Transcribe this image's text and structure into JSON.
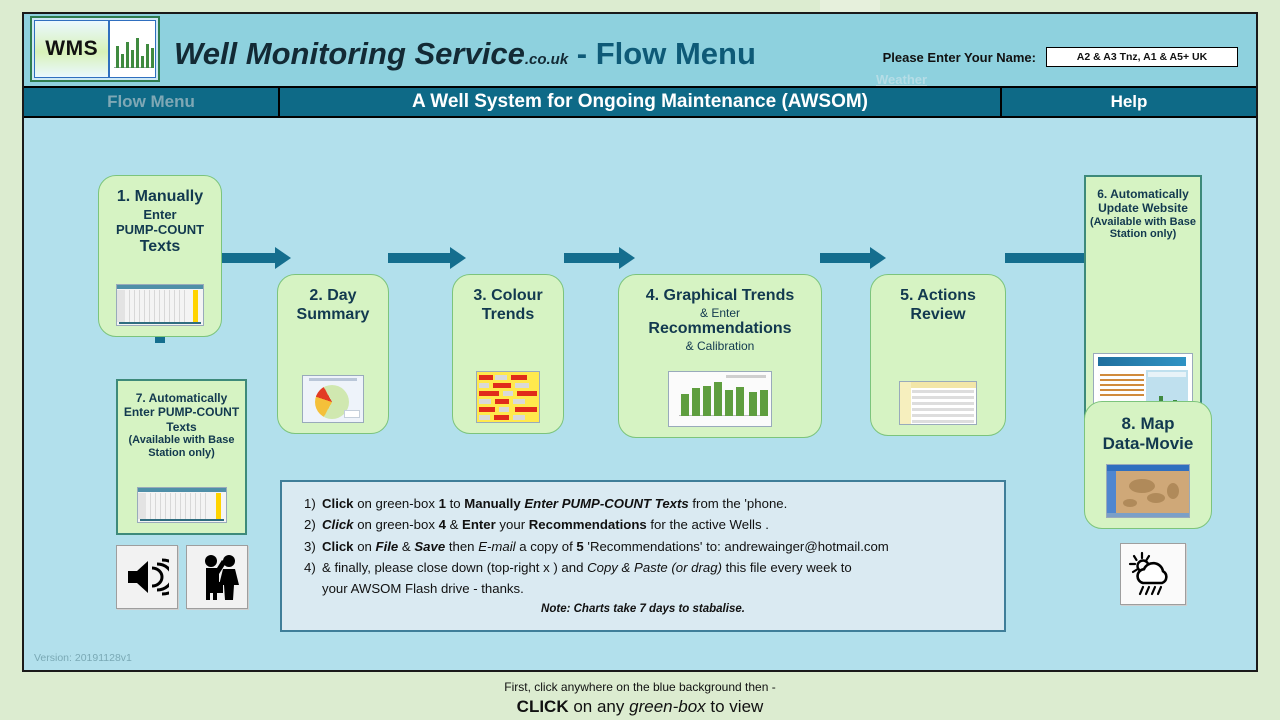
{
  "header": {
    "logo_word": "WMS",
    "brand_name": "Well Monitoring Service",
    "brand_tld": ".co.uk",
    "brand_suffix": " - Flow Menu",
    "name_label": "Please Enter Your Name:",
    "name_value": "A2 & A3 Tnz, A1 & A5+ UK",
    "weather_link": "Weather"
  },
  "nav": {
    "flow_menu": "Flow Menu",
    "title": "A Well System for Ongoing Maintenance  (AWSOM)",
    "help": "Help"
  },
  "boxes": {
    "b1": {
      "l1": "1. Manually",
      "l2": "Enter",
      "l3": "PUMP-COUNT",
      "l4": "Texts"
    },
    "b2": {
      "l1": "2. Day",
      "l2": "Summary"
    },
    "b3": {
      "l1": "3. Colour",
      "l2": "Trends"
    },
    "b4": {
      "l1": "4. Graphical Trends",
      "l2": "& Enter",
      "l3": "Recommendations",
      "l4": "& Calibration"
    },
    "b5": {
      "l1": "5. Actions",
      "l2": "Review"
    },
    "b6": {
      "l1": "6. Automatically",
      "l2": "Update Website",
      "l3": "(Available with Base",
      "l4": "Station only)"
    },
    "b7": {
      "l1": "7. Automatically",
      "l2": "Enter PUMP-COUNT",
      "l3": "Texts",
      "l4": "(Available with Base",
      "l5": "Station only)"
    },
    "b8": {
      "l1": "8. Map",
      "l2": "Data-Movie"
    }
  },
  "instructions": {
    "items": [
      {
        "num": "1)",
        "parts": [
          {
            "t": "Click",
            "s": "b"
          },
          {
            "t": " on green-box ",
            "s": "n"
          },
          {
            "t": "1",
            "s": "b"
          },
          {
            "t": " to ",
            "s": "n"
          },
          {
            "t": "Manually ",
            "s": "b"
          },
          {
            "t": "Enter PUMP-COUNT Texts",
            "s": "bi"
          },
          {
            "t": "  from the 'phone.",
            "s": "n"
          }
        ]
      },
      {
        "num": "2)",
        "parts": [
          {
            "t": "Click",
            "s": "bi"
          },
          {
            "t": "  on  green-box ",
            "s": "n"
          },
          {
            "t": "4",
            "s": "b"
          },
          {
            "t": " & ",
            "s": "n"
          },
          {
            "t": "Enter",
            "s": "b"
          },
          {
            "t": " your ",
            "s": "n"
          },
          {
            "t": "Recommendations",
            "s": "b"
          },
          {
            "t": " for the active Wells .",
            "s": "n"
          }
        ]
      },
      {
        "num": "3)",
        "parts": [
          {
            "t": "Click",
            "s": "b"
          },
          {
            "t": " on ",
            "s": "n"
          },
          {
            "t": "File",
            "s": "bi"
          },
          {
            "t": "  & ",
            "s": "n"
          },
          {
            "t": "Save",
            "s": "bi"
          },
          {
            "t": "  then ",
            "s": "n"
          },
          {
            "t": "E-mail",
            "s": "i"
          },
          {
            "t": "  a copy of ",
            "s": "n"
          },
          {
            "t": "5",
            "s": "b"
          },
          {
            "t": "  'Recommendations' to:  andrewainger@hotmail.com",
            "s": "n"
          }
        ]
      },
      {
        "num": "4)",
        "parts": [
          {
            "t": "&  finally,  please close down (top-right x )  and  ",
            "s": "n"
          },
          {
            "t": "Copy & Paste (or drag)",
            "s": "i"
          },
          {
            "t": "  this file every week to",
            "s": "n"
          }
        ]
      },
      {
        "num": "",
        "parts": [
          {
            "t": "your AWSOM Flash drive - thanks.",
            "s": "n"
          }
        ]
      }
    ],
    "note": "Note: Charts take 7 days to stabalise."
  },
  "footer": {
    "line1": "First, click anywhere on the blue background then -",
    "line2_click": "CLICK",
    "line2_mid": " on any ",
    "line2_em": "green-box",
    "line2_end": " to view"
  },
  "version": "Version: 20191128v1",
  "icons": {
    "speaker": "speaker-icon",
    "accessibility": "people-briefcase-icon",
    "weather": "sun-cloud-rain-icon"
  },
  "colors": {
    "band": "#8ed1de",
    "canvas": "#b2e0ec",
    "nav": "#0e6a87",
    "green_box": "#d6f3c3",
    "arrow": "#146e8e",
    "outer": "#dcecd0"
  }
}
